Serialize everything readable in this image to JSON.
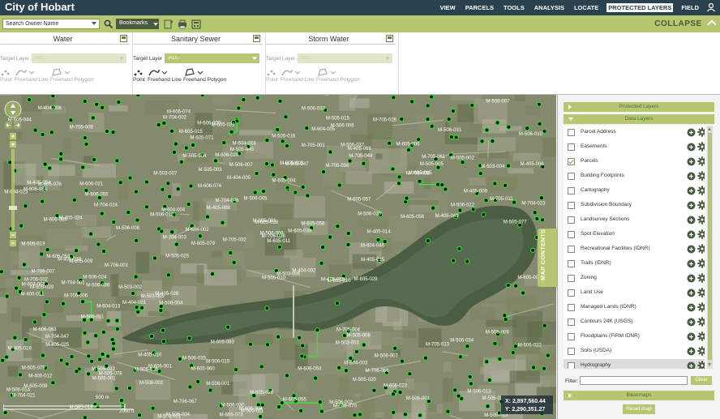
{
  "app": {
    "title": "City of Hobart"
  },
  "topnav": {
    "items": [
      {
        "label": "VIEW",
        "active": false
      },
      {
        "label": "PARCELS",
        "active": false
      },
      {
        "label": "TOOLS",
        "active": false
      },
      {
        "label": "ANALYSIS",
        "active": false
      },
      {
        "label": "LOCATE",
        "active": false
      },
      {
        "label": "PROTECTED LAYERS",
        "active": true
      },
      {
        "label": "FIELD",
        "active": false
      }
    ],
    "user_icon": "user-icon"
  },
  "toolbar": {
    "search_placeholder": "Search Owner Name",
    "bookmarks_label": "Bookmarks",
    "icons": [
      "search-icon",
      "add-bookmark-icon",
      "print-icon",
      "measure-icon"
    ],
    "collapse_label": "COLLAPSE"
  },
  "edit_sections": [
    {
      "title": "Water",
      "target_label": "Target Layer",
      "target_value": "-ALL-",
      "enabled": false,
      "tools": [
        "Point",
        "Freehand Line",
        "Freehand Polygon"
      ]
    },
    {
      "title": "Sanitary Sewer",
      "target_label": "Target Layer",
      "target_value": "-ALL-",
      "enabled": true,
      "tools": [
        "Point",
        "Freehand Line",
        "Freehand Polygon"
      ]
    },
    {
      "title": "Storm Water",
      "target_label": "Target Layer",
      "target_value": "-ALL-",
      "enabled": false,
      "tools": [
        "Point",
        "Freehand Line",
        "Freehand Polygon"
      ]
    }
  ],
  "map": {
    "scale_m": "500 m",
    "scale_ft": "2000 ft",
    "coord_x": "X: 2,897,560.44",
    "coord_y": "Y: 2,290,351.27",
    "map_contents_label": "MAP CONTENTS",
    "labels": [
      "M-404-046",
      "M-404-006",
      "M-404-005",
      "M-404-001",
      "M-404-002",
      "M-405-055",
      "M-405-068",
      "M-405-054",
      "M-405-014",
      "M-405-049",
      "M-405-011",
      "M-405-010",
      "M-405-009",
      "M-405-012",
      "M-405-015",
      "M-405-008",
      "M-405-006",
      "M-405-018",
      "M-405-019",
      "M-405-024",
      "M-405-026",
      "M-405-025",
      "M-503-001",
      "M-503-002",
      "M-503-003",
      "M-503-004",
      "M-503-005",
      "M-503-006",
      "M-503-007",
      "M-505-001",
      "M-505-002",
      "M-505-003",
      "M-505-004",
      "M-505-005",
      "M-505-008",
      "M-505-009",
      "M-505-010",
      "M-505-011",
      "M-505-012",
      "M-505-013",
      "M-505-015",
      "M-505-016",
      "M-505-018",
      "M-505-019",
      "M-505-020",
      "M-505-021",
      "M-505-025",
      "M-505-029",
      "M-505-045",
      "M-505-047",
      "M-505-077",
      "M-505-078",
      "M-505-079",
      "M-506-001",
      "M-506-002",
      "M-506-003",
      "M-506-004",
      "M-506-005",
      "M-506-006",
      "M-506-007",
      "M-506-008",
      "M-506-009",
      "M-506-010",
      "M-506-011",
      "M-506-012",
      "M-506-013",
      "M-506-014",
      "M-506-015",
      "M-506-019",
      "M-506-020",
      "M-506-022",
      "M-506-024",
      "M-506-030",
      "M-506-031",
      "M-506-032",
      "M-506-033",
      "M-506-034",
      "M-506-035",
      "M-506-036",
      "M-506-037",
      "M-508-001",
      "M-508-002",
      "M-508-004",
      "M-508-007",
      "M-604-001",
      "M-604-002",
      "M-604-003",
      "M-604-004",
      "M-604-005",
      "M-604-013",
      "M-604-023",
      "M-604-024",
      "M-605-001",
      "M-605-002",
      "M-605-003",
      "M-605-004",
      "M-605-005",
      "M-605-006",
      "M-605-008",
      "M-605-009",
      "M-605-010",
      "M-605-011",
      "M-605-015",
      "M-605-026",
      "M-605-028",
      "M-605-029",
      "M-605-031",
      "M-605-038",
      "M-605-044",
      "M-605-055",
      "M-605-056",
      "M-605-057",
      "M-605-058",
      "M-605-060",
      "M-605-070",
      "M-605-071",
      "M-605-073",
      "M-605-074",
      "M-605-076",
      "M-605-079",
      "M-606-001",
      "M-606-004",
      "M-606-005",
      "M-606-020",
      "M-606-021",
      "M-606-023",
      "M-606-053",
      "M-606-054",
      "M-606-055",
      "M-606-063",
      "M-606-074",
      "M-606-083",
      "M-606-084",
      "M-606-088",
      "M-704-001",
      "M-704-002",
      "M-704-003",
      "M-704-021",
      "M-704-023",
      "M-704-024",
      "M-704-046",
      "M-704-047",
      "M-705-001",
      "M-705-002",
      "M-705-004",
      "M-705-006",
      "M-705-009",
      "M-705-010",
      "M-705-011",
      "M-705-026",
      "M-705-032",
      "M-705-044",
      "M-705-056",
      "M-705-061",
      "M-706-001",
      "M-706-006",
      "M-706-007",
      "M-706-008",
      "M-706-066",
      "M-706-067"
    ]
  },
  "panel": {
    "protected_layers_label": "Protected Layers",
    "data_layers_label": "Data Layers",
    "layers": [
      {
        "name": "Parcel Address",
        "checked": false
      },
      {
        "name": "Easements",
        "checked": false
      },
      {
        "name": "Parcels",
        "checked": true
      },
      {
        "name": "Building Footprints",
        "checked": false
      },
      {
        "name": "Cartography",
        "checked": false
      },
      {
        "name": "Subdivision Boundary",
        "checked": false
      },
      {
        "name": "Landsurvey Sections",
        "checked": false
      },
      {
        "name": "Spot Elevation",
        "checked": false
      },
      {
        "name": "Recreational Facilities (IDNR)",
        "checked": false
      },
      {
        "name": "Trails (IDNR)",
        "checked": false
      },
      {
        "name": "Zoning",
        "checked": false
      },
      {
        "name": "Land Use",
        "checked": false
      },
      {
        "name": "Managed Lands (IDNR)",
        "checked": false
      },
      {
        "name": "Contours 24K (USGS)",
        "checked": false
      },
      {
        "name": "Floodplains (FIRM IDNR)",
        "checked": false
      },
      {
        "name": "Soils (USDA)",
        "checked": false
      },
      {
        "name": "Hydrography",
        "checked": false
      }
    ],
    "filter_label": "Filter:",
    "filter_value": "",
    "clear_label": "Clear",
    "basemaps_label": "Basemaps",
    "reset_map_label": "Reset map"
  }
}
